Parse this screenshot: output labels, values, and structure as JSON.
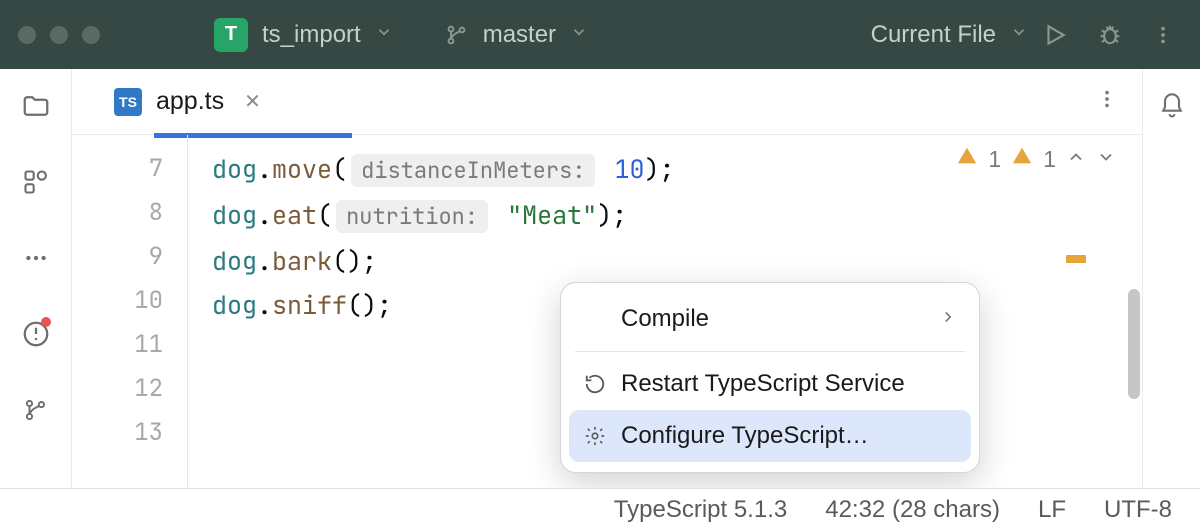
{
  "title_bar": {
    "project_initial": "T",
    "project_name": "ts_import",
    "branch": "master",
    "run_config": "Current File"
  },
  "tabs": {
    "active": {
      "name": "app.ts",
      "icon_text": "TS"
    }
  },
  "editor": {
    "gutter_start": 7,
    "gutter_end": 13,
    "lines": [
      {
        "var": "dog",
        "method": "move",
        "hint": "distanceInMeters:",
        "valueType": "num",
        "value": "10",
        "trailing": ");"
      },
      {
        "var": "dog",
        "method": "eat",
        "hint": "nutrition:",
        "valueType": "str",
        "value": "\"Meat\"",
        "trailing": ");"
      },
      {
        "var": "dog",
        "method": "bark",
        "trailing": "();"
      },
      {
        "var": "dog",
        "method": "sniff",
        "trailing": "();"
      }
    ]
  },
  "inspections": {
    "warn1": "1",
    "warn2": "1"
  },
  "context_menu": {
    "compile": "Compile",
    "restart": "Restart TypeScript Service",
    "configure": "Configure TypeScript…"
  },
  "status_bar": {
    "ts_version": "TypeScript 5.1.3",
    "caret": "42:32 (28 chars)",
    "line_sep": "LF",
    "encoding": "UTF-8"
  }
}
